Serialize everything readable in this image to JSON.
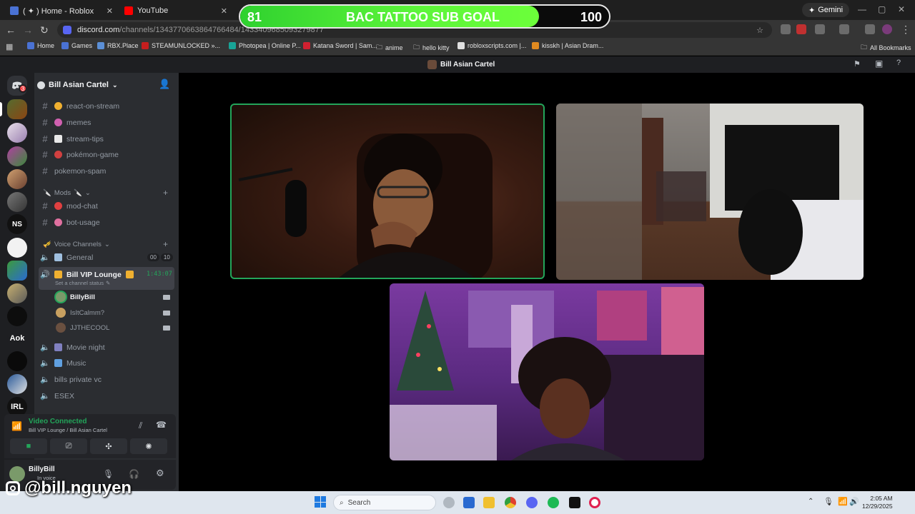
{
  "browser": {
    "tabs": [
      {
        "title": "( ✦ ) Home - Roblox"
      },
      {
        "title": "YouTube"
      }
    ],
    "gemini_label": "Gemini",
    "url_main": "discord.com",
    "url_rest": "/channels/1343770663864766484/1433409685093279877",
    "bookmarks": [
      "Home",
      "Games",
      "RBX.Place",
      "STEAMUNLOCKED »...",
      "Photopea | Online P...",
      "Katana Sword | Sam...",
      "anime",
      "hello kitty",
      "robloxscripts.com |...",
      "kisskh | Asian Dram...",
      "All Bookmarks"
    ]
  },
  "overlay": {
    "subgoal_current": "81",
    "subgoal_title": "BAC TATTOO SUB GOAL",
    "subgoal_target": "100",
    "subgoal_progress": 0.81,
    "watermark": "@bill.nguyen"
  },
  "discord": {
    "window_title": "Bill Asian Cartel",
    "rail_badge": "3",
    "rail_text_servers": [
      "NS",
      "Aok",
      "IRL"
    ],
    "server_name": "Bill Asian Cartel",
    "text_channels": [
      "react-on-stream",
      "memes",
      "stream-tips",
      "pokémon-game",
      "pokemon-spam"
    ],
    "mods_category": "Mods",
    "mod_channels": [
      "mod-chat",
      "bot-usage"
    ],
    "voice_category": "Voice Channels",
    "voice_channels": {
      "general": "General",
      "general_count_a": "00",
      "general_count_b": "10",
      "lounge": "Bill VIP Lounge",
      "lounge_timer": "1:43:07",
      "lounge_status": "Set a channel status",
      "users": [
        "BillyBill",
        "IsItCalmm?",
        "JJTHECOOL"
      ],
      "others": [
        "Movie night",
        "Music",
        "bills private vc",
        "ESEX"
      ]
    },
    "voice_panel": {
      "status": "Video Connected",
      "location": "Bill VIP Lounge / Bill Asian Cartel"
    },
    "user_panel": {
      "username": "BillyBill",
      "status": "In voice"
    }
  },
  "taskbar": {
    "search_placeholder": "Search",
    "time": "2:05 AM",
    "date": "12/29/2025"
  },
  "colors": {
    "accent_green": "#23a55a",
    "discord_bg": "#2b2d31",
    "rail_bg": "#1e1f22"
  }
}
